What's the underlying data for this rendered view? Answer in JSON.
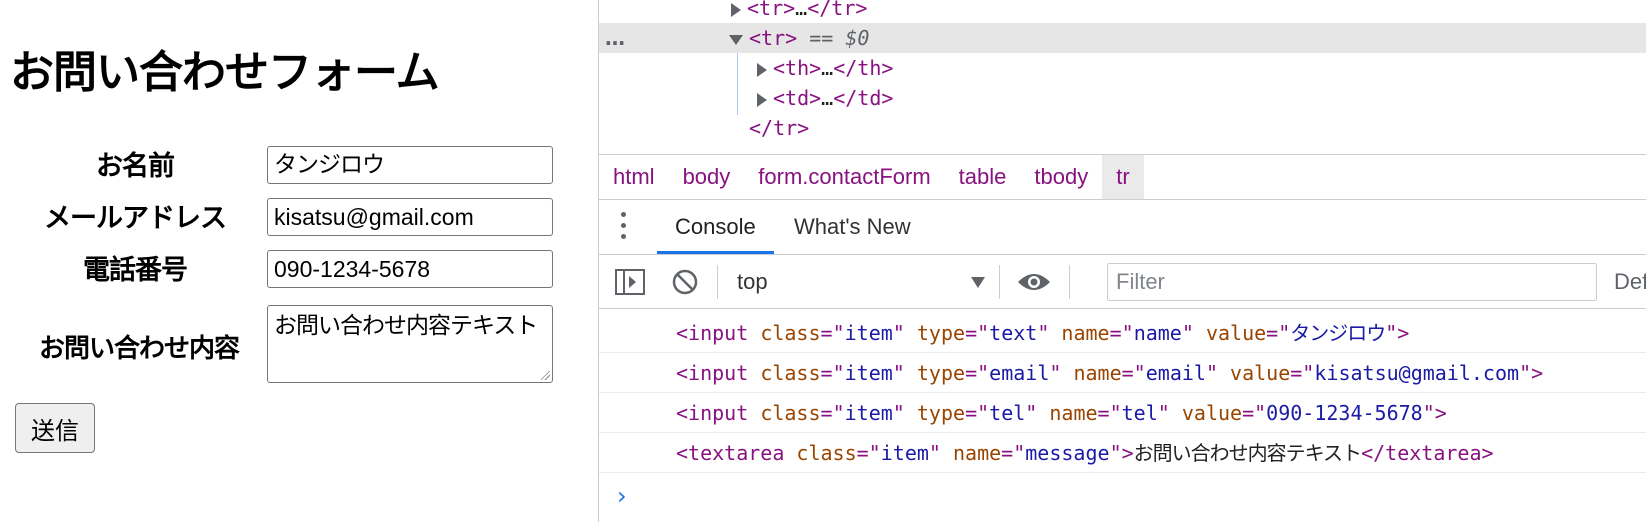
{
  "form": {
    "title": "お問い合わせフォーム",
    "fields": {
      "name_label": "お名前",
      "name_value": "タンジロウ",
      "email_label": "メールアドレス",
      "email_value": "kisatsu@gmail.com",
      "tel_label": "電話番号",
      "tel_value": "090-1234-5678",
      "message_label": "お問い合わせ内容",
      "message_value": "お問い合わせ内容テキスト"
    },
    "submit_label": "送信"
  },
  "devtools": {
    "elements_tree": {
      "row0_open": "<tr>",
      "row0_ellipsis": "…",
      "row0_close": "</tr>",
      "row1_open": "<tr>",
      "row1_marker": " == $0",
      "row2_open": "<th>",
      "row2_ellipsis": "…",
      "row2_close": "</th>",
      "row3_open": "<td>",
      "row3_ellipsis": "…",
      "row3_close": "</td>",
      "row4_close": "</tr>",
      "dots": "…"
    },
    "breadcrumbs": [
      "html",
      "body",
      "form.contactForm",
      "table",
      "tbody",
      "tr"
    ],
    "drawer_tabs": {
      "console": "Console",
      "whats_new": "What's New"
    },
    "toolbar": {
      "context": "top",
      "filter_placeholder": "Filter",
      "levels": "Def"
    },
    "console": {
      "line1": {
        "tag": "input",
        "class": "item",
        "type": "text",
        "name": "name",
        "value": "タンジロウ"
      },
      "line2": {
        "tag": "input",
        "class": "item",
        "type": "email",
        "name": "email",
        "value": "kisatsu@gmail.com"
      },
      "line3": {
        "tag": "input",
        "class": "item",
        "type": "tel",
        "name": "tel",
        "value": "090-1234-5678"
      },
      "line4": {
        "tag": "textarea",
        "class": "item",
        "name": "message",
        "content": "お問い合わせ内容テキスト",
        "close": "textarea"
      },
      "prompt": "›"
    }
  }
}
